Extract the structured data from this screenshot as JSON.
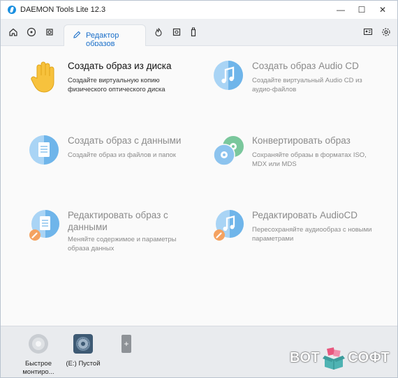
{
  "window": {
    "title": "DAEMON Tools Lite 12.3",
    "controls": {
      "minimize": "—",
      "maximize": "☐",
      "close": "✕"
    }
  },
  "toolbar": {
    "active_tab_label": "Редактор образов",
    "left_icons": [
      "home-icon",
      "add-disc-icon",
      "image-catalog-icon"
    ],
    "right_icons": [
      "burn-icon",
      "image-editor-icon",
      "usb-icon"
    ],
    "far_right_icons": [
      "license-icon",
      "settings-icon"
    ]
  },
  "actions": [
    {
      "title": "Создать образ из диска",
      "description": "Создайте виртуальную копию физического оптического диска",
      "enabled": true,
      "icon": "hand-icon"
    },
    {
      "title": "Создать образ Audio CD",
      "description": "Создайте виртуальный Audio CD из аудио-файлов",
      "enabled": false,
      "icon": "audio-cd-icon"
    },
    {
      "title": "Создать образ с данными",
      "description": "Создайте образ из файлов и папок",
      "enabled": false,
      "icon": "data-disc-icon"
    },
    {
      "title": "Конвертировать образ",
      "description": "Сохраняйте образы в форматах ISO, MDX или MDS",
      "enabled": false,
      "icon": "convert-icon"
    },
    {
      "title": "Редактировать образ с данными",
      "description": "Меняйте содержимое и параметры образа данных",
      "enabled": false,
      "icon": "edit-data-icon"
    },
    {
      "title": "Редактировать AudioCD",
      "description": "Пересохраняйте аудиообраз с новыми параметрами",
      "enabled": false,
      "icon": "edit-audio-icon"
    }
  ],
  "drives": [
    {
      "label": "Быстрое монтиро...",
      "icon": "quick-mount-icon"
    },
    {
      "label": "(E:) Пустой",
      "icon": "virtual-drive-icon"
    }
  ],
  "add_drive_label": "+",
  "watermark": {
    "left": "ВОТ",
    "right": "СОФТ"
  },
  "colors": {
    "accent": "#1a6fc9",
    "icon_blue": "#5aa9e6",
    "icon_light": "#a9d4f5",
    "edit_orange": "#f4a261",
    "convert_green": "#7ac79c"
  }
}
